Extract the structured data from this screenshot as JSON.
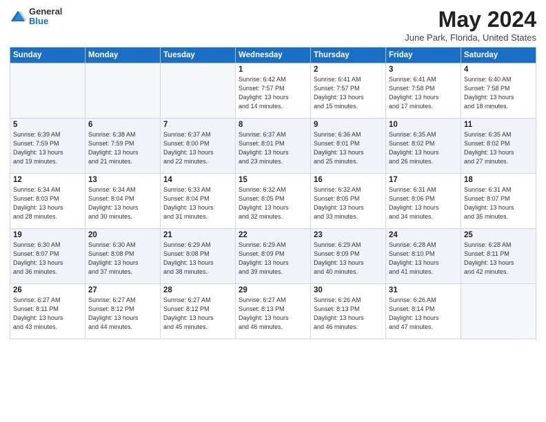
{
  "header": {
    "logo_general": "General",
    "logo_blue": "Blue",
    "title": "May 2024",
    "location": "June Park, Florida, United States"
  },
  "days_of_week": [
    "Sunday",
    "Monday",
    "Tuesday",
    "Wednesday",
    "Thursday",
    "Friday",
    "Saturday"
  ],
  "weeks": [
    [
      {
        "day": "",
        "info": ""
      },
      {
        "day": "",
        "info": ""
      },
      {
        "day": "",
        "info": ""
      },
      {
        "day": "1",
        "info": "Sunrise: 6:42 AM\nSunset: 7:57 PM\nDaylight: 13 hours\nand 14 minutes."
      },
      {
        "day": "2",
        "info": "Sunrise: 6:41 AM\nSunset: 7:57 PM\nDaylight: 13 hours\nand 15 minutes."
      },
      {
        "day": "3",
        "info": "Sunrise: 6:41 AM\nSunset: 7:58 PM\nDaylight: 13 hours\nand 17 minutes."
      },
      {
        "day": "4",
        "info": "Sunrise: 6:40 AM\nSunset: 7:58 PM\nDaylight: 13 hours\nand 18 minutes."
      }
    ],
    [
      {
        "day": "5",
        "info": "Sunrise: 6:39 AM\nSunset: 7:59 PM\nDaylight: 13 hours\nand 19 minutes."
      },
      {
        "day": "6",
        "info": "Sunrise: 6:38 AM\nSunset: 7:59 PM\nDaylight: 13 hours\nand 21 minutes."
      },
      {
        "day": "7",
        "info": "Sunrise: 6:37 AM\nSunset: 8:00 PM\nDaylight: 13 hours\nand 22 minutes."
      },
      {
        "day": "8",
        "info": "Sunrise: 6:37 AM\nSunset: 8:01 PM\nDaylight: 13 hours\nand 23 minutes."
      },
      {
        "day": "9",
        "info": "Sunrise: 6:36 AM\nSunset: 8:01 PM\nDaylight: 13 hours\nand 25 minutes."
      },
      {
        "day": "10",
        "info": "Sunrise: 6:35 AM\nSunset: 8:02 PM\nDaylight: 13 hours\nand 26 minutes."
      },
      {
        "day": "11",
        "info": "Sunrise: 6:35 AM\nSunset: 8:02 PM\nDaylight: 13 hours\nand 27 minutes."
      }
    ],
    [
      {
        "day": "12",
        "info": "Sunrise: 6:34 AM\nSunset: 8:03 PM\nDaylight: 13 hours\nand 28 minutes."
      },
      {
        "day": "13",
        "info": "Sunrise: 6:34 AM\nSunset: 8:04 PM\nDaylight: 13 hours\nand 30 minutes."
      },
      {
        "day": "14",
        "info": "Sunrise: 6:33 AM\nSunset: 8:04 PM\nDaylight: 13 hours\nand 31 minutes."
      },
      {
        "day": "15",
        "info": "Sunrise: 6:32 AM\nSunset: 8:05 PM\nDaylight: 13 hours\nand 32 minutes."
      },
      {
        "day": "16",
        "info": "Sunrise: 6:32 AM\nSunset: 8:05 PM\nDaylight: 13 hours\nand 33 minutes."
      },
      {
        "day": "17",
        "info": "Sunrise: 6:31 AM\nSunset: 8:06 PM\nDaylight: 13 hours\nand 34 minutes."
      },
      {
        "day": "18",
        "info": "Sunrise: 6:31 AM\nSunset: 8:07 PM\nDaylight: 13 hours\nand 35 minutes."
      }
    ],
    [
      {
        "day": "19",
        "info": "Sunrise: 6:30 AM\nSunset: 8:07 PM\nDaylight: 13 hours\nand 36 minutes."
      },
      {
        "day": "20",
        "info": "Sunrise: 6:30 AM\nSunset: 8:08 PM\nDaylight: 13 hours\nand 37 minutes."
      },
      {
        "day": "21",
        "info": "Sunrise: 6:29 AM\nSunset: 8:08 PM\nDaylight: 13 hours\nand 38 minutes."
      },
      {
        "day": "22",
        "info": "Sunrise: 6:29 AM\nSunset: 8:09 PM\nDaylight: 13 hours\nand 39 minutes."
      },
      {
        "day": "23",
        "info": "Sunrise: 6:29 AM\nSunset: 8:09 PM\nDaylight: 13 hours\nand 40 minutes."
      },
      {
        "day": "24",
        "info": "Sunrise: 6:28 AM\nSunset: 8:10 PM\nDaylight: 13 hours\nand 41 minutes."
      },
      {
        "day": "25",
        "info": "Sunrise: 6:28 AM\nSunset: 8:11 PM\nDaylight: 13 hours\nand 42 minutes."
      }
    ],
    [
      {
        "day": "26",
        "info": "Sunrise: 6:27 AM\nSunset: 8:11 PM\nDaylight: 13 hours\nand 43 minutes."
      },
      {
        "day": "27",
        "info": "Sunrise: 6:27 AM\nSunset: 8:12 PM\nDaylight: 13 hours\nand 44 minutes."
      },
      {
        "day": "28",
        "info": "Sunrise: 6:27 AM\nSunset: 8:12 PM\nDaylight: 13 hours\nand 45 minutes."
      },
      {
        "day": "29",
        "info": "Sunrise: 6:27 AM\nSunset: 8:13 PM\nDaylight: 13 hours\nand 46 minutes."
      },
      {
        "day": "30",
        "info": "Sunrise: 6:26 AM\nSunset: 8:13 PM\nDaylight: 13 hours\nand 46 minutes."
      },
      {
        "day": "31",
        "info": "Sunrise: 6:26 AM\nSunset: 8:14 PM\nDaylight: 13 hours\nand 47 minutes."
      },
      {
        "day": "",
        "info": ""
      }
    ]
  ]
}
